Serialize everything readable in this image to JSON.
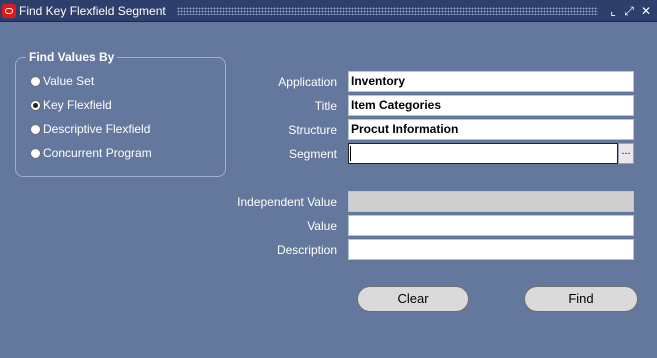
{
  "window": {
    "title": "Find Key Flexfield Segment",
    "buttons": {
      "minimize": "⌞",
      "maximize": "⤢",
      "close": "✕"
    },
    "app_icon": "oracle-icon"
  },
  "find_values_by": {
    "title": "Find Values By",
    "options": [
      {
        "label": "Value Set",
        "checked": false
      },
      {
        "label": "Key Flexfield",
        "checked": true
      },
      {
        "label": "Descriptive Flexfield",
        "checked": false
      },
      {
        "label": "Concurrent Program",
        "checked": false
      }
    ]
  },
  "form": {
    "application": {
      "label": "Application",
      "value": "Inventory"
    },
    "title": {
      "label": "Title",
      "value": "Item Categories"
    },
    "structure": {
      "label": "Structure",
      "value": "Procut Information"
    },
    "segment": {
      "label": "Segment",
      "value": "",
      "lov_label": "..."
    },
    "independent_value": {
      "label": "Independent Value",
      "value": ""
    },
    "value": {
      "label": "Value",
      "value": ""
    },
    "description": {
      "label": "Description",
      "value": ""
    }
  },
  "actions": {
    "clear": "Clear",
    "find": "Find"
  },
  "colors": {
    "background": "#64779d",
    "titlebar": "#2e3f6b",
    "icon": "#e11919"
  }
}
